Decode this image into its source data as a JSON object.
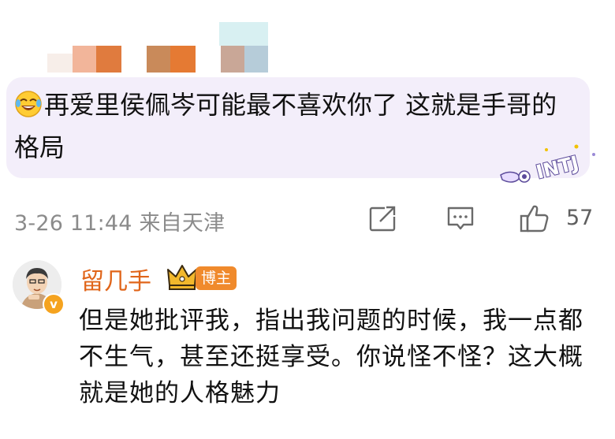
{
  "comment": {
    "text": "再爱里侯佩岑可能最不喜欢你了 这就是手哥的格局",
    "emoji_icon": "laughing-tears-emoji",
    "decoration_text": "INTJ",
    "bubble_color": "#f3eefa"
  },
  "meta": {
    "timestamp": "3-26 11:44",
    "location": "来自天津",
    "like_count": "57",
    "icons": [
      "share-icon",
      "comment-icon",
      "like-icon"
    ]
  },
  "reply": {
    "author_name": "留几手",
    "author_badge": "博主",
    "verified_mark": "v",
    "text": "但是她批评我，指出我问题的时候，我一点都不生气，甚至还挺享受。你说怪不怪？这大概就是她的人格魅力",
    "name_color": "#e0651a"
  }
}
